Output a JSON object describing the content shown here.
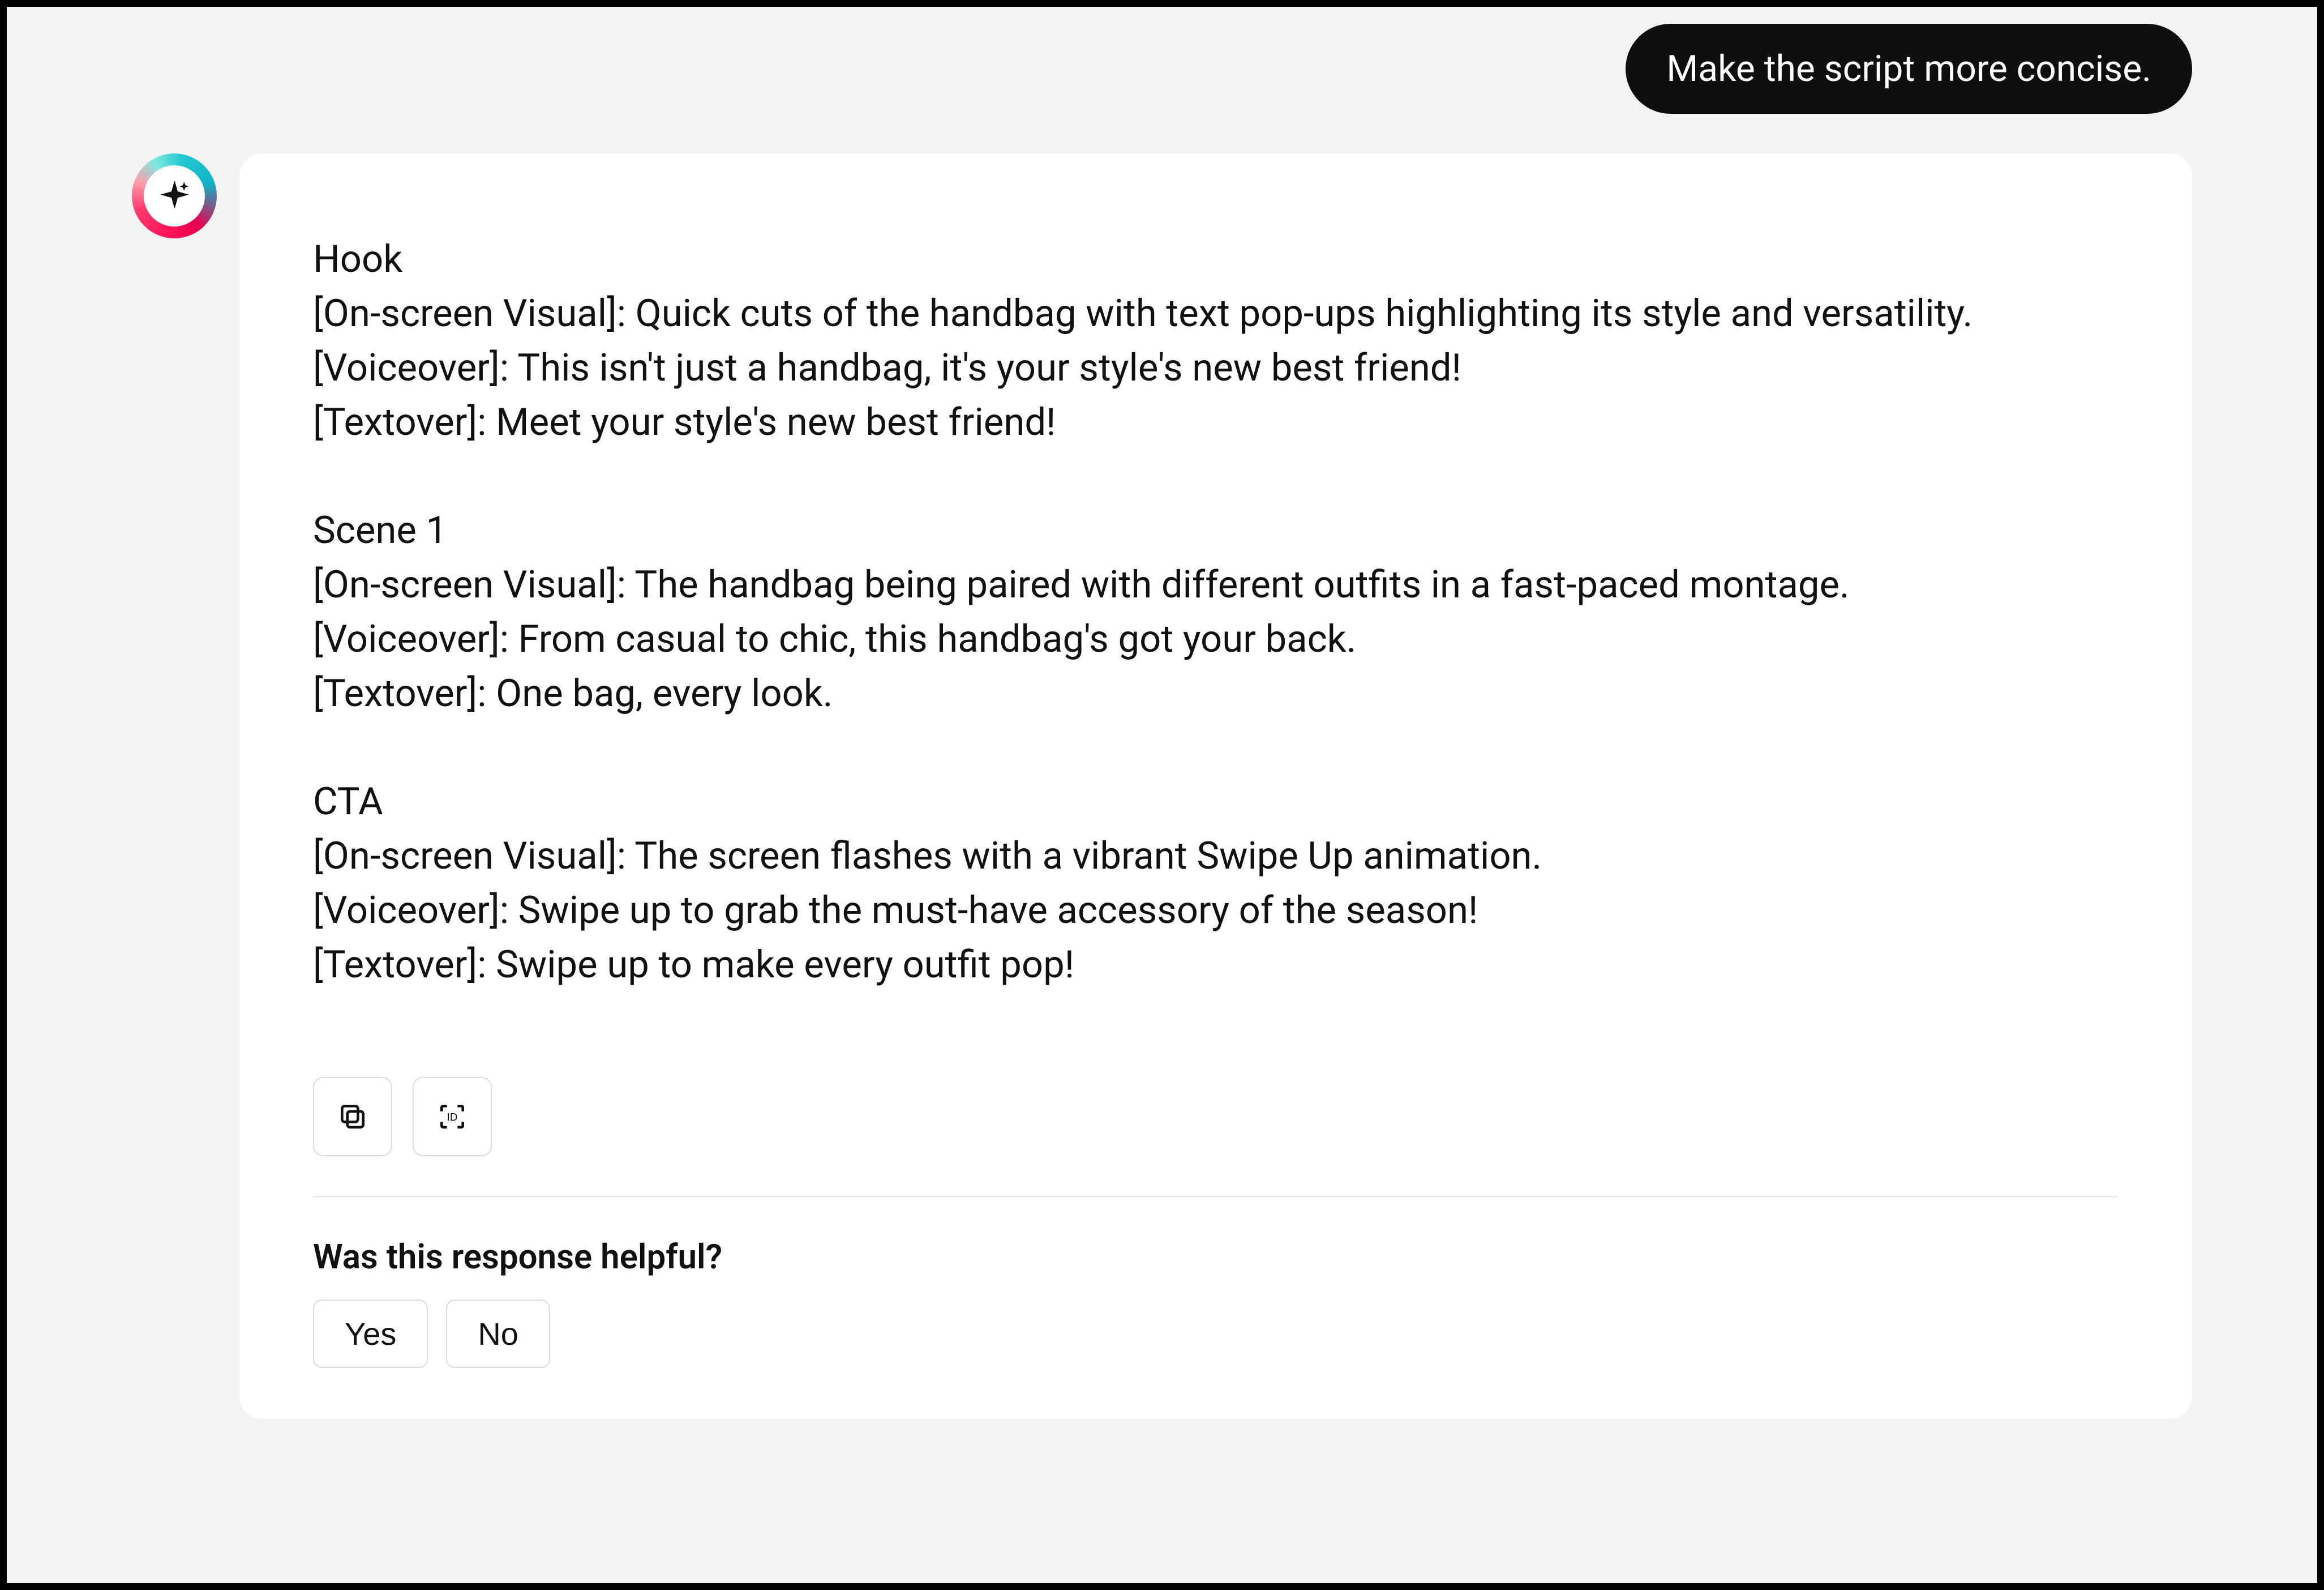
{
  "user_message": "Make the script more concise.",
  "assistant_script": "Hook\n[On-screen Visual]: Quick cuts of the handbag with text pop-ups highlighting its style and versatility.\n[Voiceover]: This isn't just a handbag, it's your style's new best friend!\n[Textover]: Meet your style's new best friend!\n\nScene 1\n[On-screen Visual]: The handbag being paired with different outfits in a fast-paced montage.\n[Voiceover]: From casual to chic, this handbag's got your back.\n[Textover]: One bag, every look.\n\nCTA\n[On-screen Visual]: The screen flashes with a vibrant Swipe Up animation.\n[Voiceover]: Swipe up to grab the must-have accessory of the season!\n[Textover]: Swipe up to make every outfit pop!",
  "actions": {
    "copy_label": "Copy",
    "id_label": "ID"
  },
  "feedback": {
    "question": "Was this response helpful?",
    "yes": "Yes",
    "no": "No"
  }
}
